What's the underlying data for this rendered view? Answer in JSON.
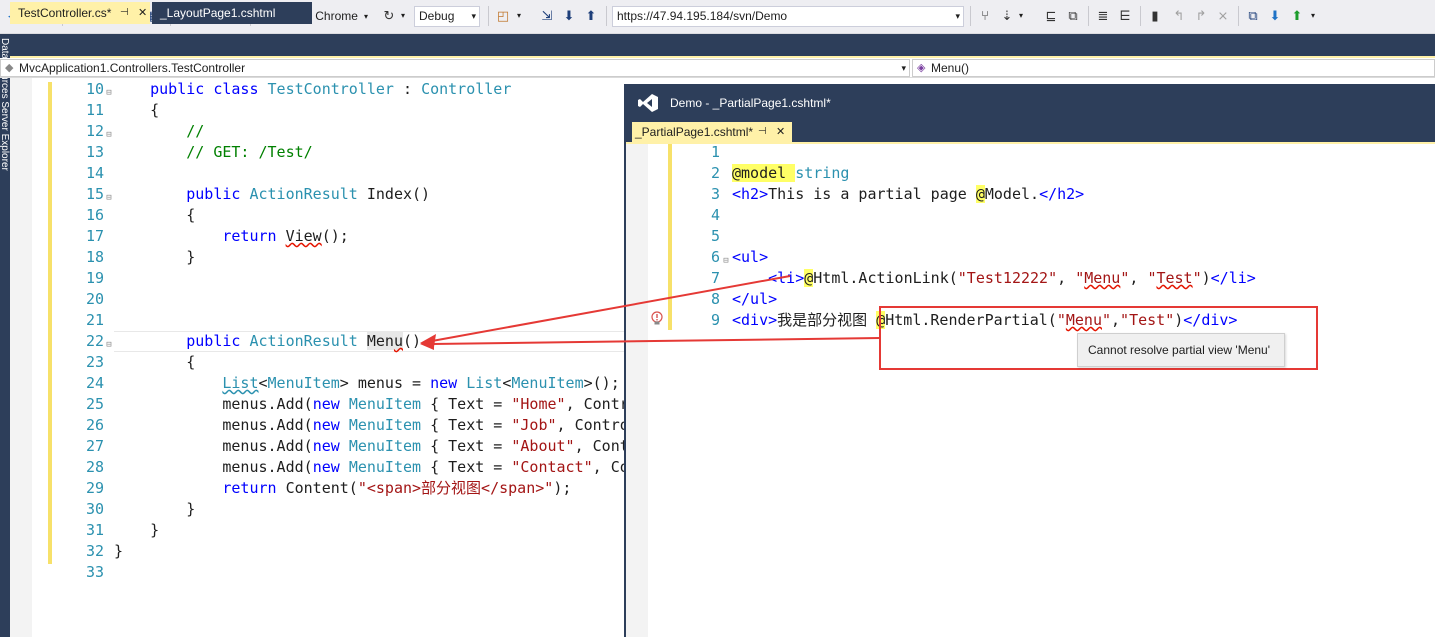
{
  "toolbar": {
    "browser_label": "Google Chrome",
    "config_value": "Debug",
    "url_value": "https://47.94.195.184/svn/Demo"
  },
  "sidebar": {
    "vertical_text": "Data Sources   Server Explorer"
  },
  "tabs": [
    {
      "label": "TestController.cs*",
      "pin": "⊣",
      "close": "✕"
    },
    {
      "label": "_LayoutPage1.cshtml"
    }
  ],
  "nav": {
    "class_path": "MvcApplication1.Controllers.TestController",
    "member": "Menu()"
  },
  "left_code": [
    {
      "n": "10",
      "o": "⊟",
      "h": "    <span class=\"kw\">public class</span> <span class=\"ty\">TestController</span> : <span class=\"ty\">Controller</span>"
    },
    {
      "n": "11",
      "o": "",
      "h": "    {"
    },
    {
      "n": "12",
      "o": "⊟",
      "h": "        <span class=\"cm\">//</span>"
    },
    {
      "n": "13",
      "o": "",
      "h": "        <span class=\"cm\">// GET: /Test/</span>"
    },
    {
      "n": "14",
      "o": "",
      "h": ""
    },
    {
      "n": "15",
      "o": "⊟",
      "h": "        <span class=\"kw\">public</span> <span class=\"ty\">ActionResult</span> Index()"
    },
    {
      "n": "16",
      "o": "",
      "h": "        {"
    },
    {
      "n": "17",
      "o": "",
      "h": "            <span class=\"kw\">return</span> <span class=\"sq\">View</span>();"
    },
    {
      "n": "18",
      "o": "",
      "h": "        }"
    },
    {
      "n": "19",
      "o": "",
      "h": ""
    },
    {
      "n": "20",
      "o": "",
      "h": ""
    },
    {
      "n": "21",
      "o": "",
      "h": ""
    },
    {
      "n": "22",
      "o": "⊟",
      "h": "        <span class=\"kw\">public</span> <span class=\"ty\">ActionResult</span> <span style=\"background:#e8e8e8\">Men<span class=\"sq\">u</span></span>()"
    },
    {
      "n": "23",
      "o": "",
      "h": "        {"
    },
    {
      "n": "24",
      "o": "",
      "h": "            <span class=\"sqg\"><span class=\"ty\">List</span></span>&lt;<span class=\"ty\">MenuItem</span>&gt; menus = <span class=\"kw\">new</span> <span class=\"ty\">List</span>&lt;<span class=\"ty\">MenuItem</span>&gt;();"
    },
    {
      "n": "25",
      "o": "",
      "h": "            menus.Add(<span class=\"kw\">new</span> <span class=\"ty\">MenuItem</span> { Text = <span class=\"st\">\"Home\"</span>, Contr"
    },
    {
      "n": "26",
      "o": "",
      "h": "            menus.Add(<span class=\"kw\">new</span> <span class=\"ty\">MenuItem</span> { Text = <span class=\"st\">\"Job\"</span>, Contro"
    },
    {
      "n": "27",
      "o": "",
      "h": "            menus.Add(<span class=\"kw\">new</span> <span class=\"ty\">MenuItem</span> { Text = <span class=\"st\">\"About\"</span>, Cont"
    },
    {
      "n": "28",
      "o": "",
      "h": "            menus.Add(<span class=\"kw\">new</span> <span class=\"ty\">MenuItem</span> { Text = <span class=\"st\">\"Contact\"</span>, Co"
    },
    {
      "n": "29",
      "o": "",
      "h": "            <span class=\"kw\">return</span> Content(<span class=\"st\">\"&lt;span&gt;部分视图&lt;/span&gt;\"</span>);"
    },
    {
      "n": "30",
      "o": "",
      "h": "        }"
    },
    {
      "n": "31",
      "o": "",
      "h": "    }"
    },
    {
      "n": "32",
      "o": "",
      "h": "}"
    },
    {
      "n": "33",
      "o": "",
      "h": ""
    }
  ],
  "float_window": {
    "title": "Demo - _PartialPage1.cshtml*",
    "tab_label": "_PartialPage1.cshtml*",
    "tab_pin": "⊣",
    "tab_close": "✕"
  },
  "right_code": [
    {
      "n": "1",
      "o": "",
      "h": ""
    },
    {
      "n": "2",
      "o": "",
      "h": "<span class=\"hl\">@model </span><span class=\"ty\">string</span>"
    },
    {
      "n": "3",
      "o": "",
      "h": "<span class=\"tag\">&lt;h2&gt;</span>This is a partial page <span class=\"hl\">@</span>Model.<span class=\"tag\">&lt;/h2&gt;</span>"
    },
    {
      "n": "4",
      "o": "",
      "h": ""
    },
    {
      "n": "5",
      "o": "",
      "h": ""
    },
    {
      "n": "6",
      "o": "⊟",
      "h": "<span class=\"tag\">&lt;ul&gt;</span>"
    },
    {
      "n": "7",
      "o": "",
      "h": "    <span class=\"tag\">&lt;li&gt;</span><span class=\"hl\">@</span>Html.ActionLink(<span class=\"st\">\"Test12222\"</span>, <span class=\"st\">\"<span class=\"sq\">Menu</span>\"</span>, <span class=\"st\">\"<span class=\"sq\">Test</span>\"</span>)<span class=\"tag\">&lt;/li&gt;</span>"
    },
    {
      "n": "8",
      "o": "",
      "h": "<span class=\"tag\">&lt;/ul&gt;</span>"
    },
    {
      "n": "9",
      "o": "",
      "h": "<span class=\"tag\">&lt;div&gt;</span>我是部分视图 <span class=\"hl\">@</span>Html.RenderPartial(<span class=\"st\">\"<span class=\"sq\">Menu</span>\"</span>,<span class=\"st\">\"Test\"</span>)<span class=\"tag\">&lt;/div&gt;</span>"
    }
  ],
  "tooltip": "Cannot resolve partial view 'Menu'",
  "colors": {
    "chrome": "#2d3e5a",
    "active_tab": "#fff1a8",
    "annotation": "#e53935"
  }
}
